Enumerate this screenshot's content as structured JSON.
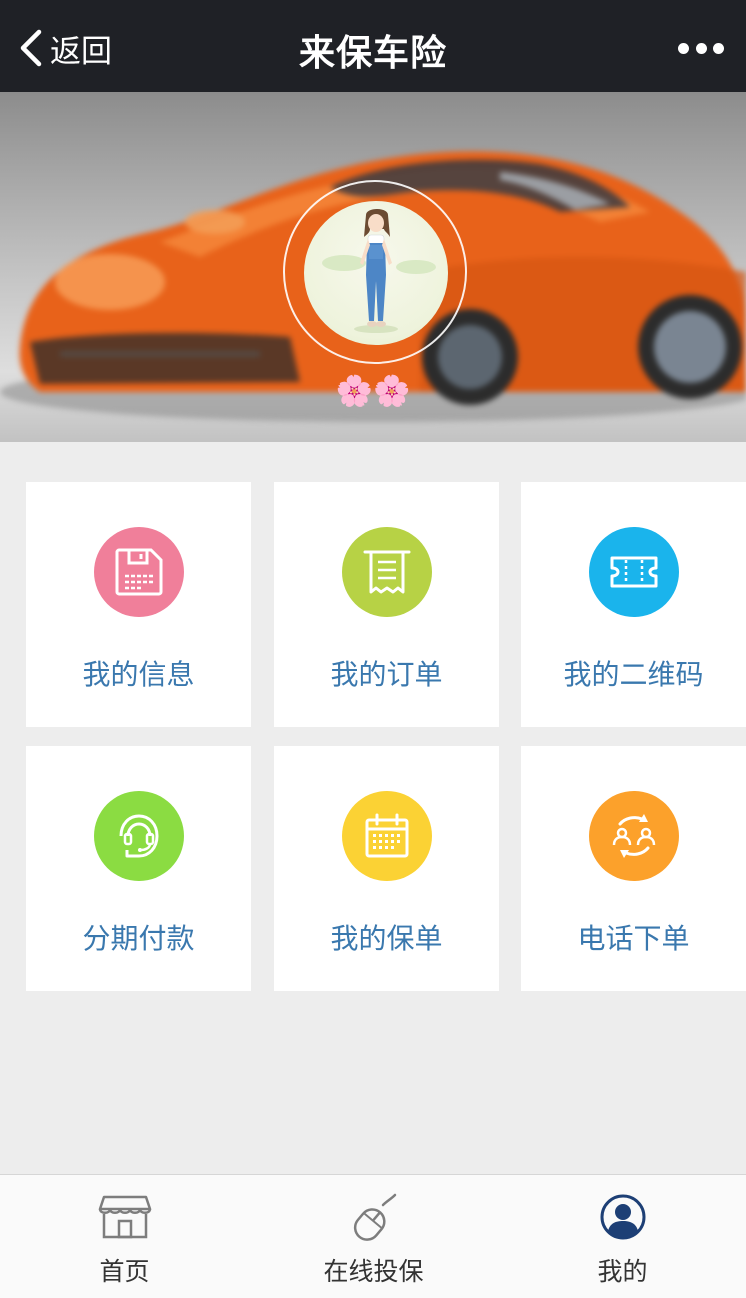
{
  "navbar": {
    "back_label": "返回",
    "title": "来保车险"
  },
  "profile": {
    "nickname": "🌸🌸"
  },
  "menu": [
    {
      "label": "我的信息",
      "icon": "save-disk-icon",
      "color": "#f07f9a"
    },
    {
      "label": "我的订单",
      "icon": "receipt-icon",
      "color": "#b7d245"
    },
    {
      "label": "我的二维码",
      "icon": "ticket-icon",
      "color": "#1ab4ec"
    },
    {
      "label": "分期付款",
      "icon": "headset-icon",
      "color": "#8bdc42"
    },
    {
      "label": "我的保单",
      "icon": "calendar-icon",
      "color": "#fbd234"
    },
    {
      "label": "电话下单",
      "icon": "users-sync-icon",
      "color": "#fca12b"
    }
  ],
  "tabbar": {
    "items": [
      {
        "label": "首页",
        "icon": "shop-icon"
      },
      {
        "label": "在线投保",
        "icon": "mouse-icon"
      },
      {
        "label": "我的",
        "icon": "user-avatar-icon",
        "active": true
      }
    ]
  },
  "colors": {
    "navbar_bg": "#1f2126",
    "tile_label": "#3a78ae",
    "page_bg": "#ededed"
  }
}
